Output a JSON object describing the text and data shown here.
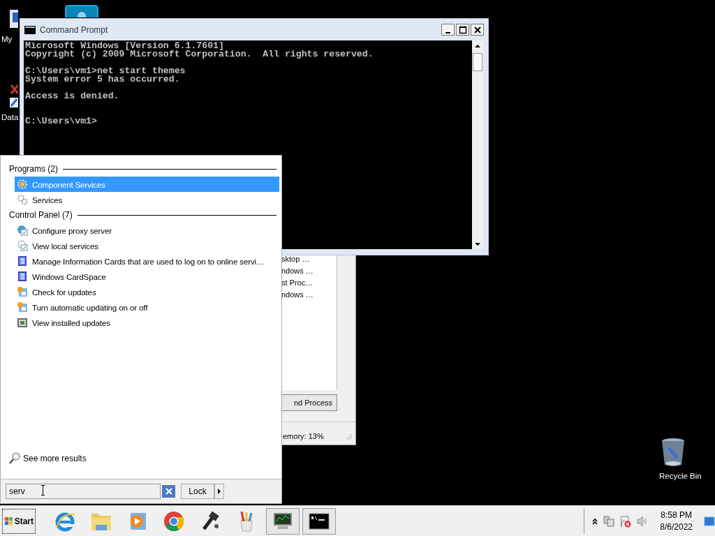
{
  "desktop_icons": [
    {
      "label": "My",
      "kind": "computer"
    },
    {
      "label": "Data",
      "kind": "shortcut"
    },
    {
      "label": "Recycle Bin",
      "kind": "bin"
    }
  ],
  "task_manager": {
    "rows": [
      "sktop …",
      "ndows …",
      "st Proc…",
      "ndows …"
    ],
    "end_button": "nd Process",
    "status": "emory: 13%"
  },
  "command_prompt": {
    "title": "Command Prompt",
    "blocks": [
      [
        "Microsoft Windows [Version 6.1.7601]",
        "Copyright (c) 2009 Microsoft Corporation.  All rights reserved."
      ],
      [
        "C:\\Users\\vm1>net start themes",
        "System error 5 has occurred."
      ],
      [
        "Access is denied."
      ],
      [
        "C:\\Users\\vm1>"
      ]
    ]
  },
  "start_menu": {
    "groups": [
      {
        "heading": "Programs (2)",
        "items": [
          {
            "label": "Component Services",
            "kind": "component",
            "selected": true
          },
          {
            "label": "Services",
            "kind": "gears",
            "selected": false
          }
        ]
      },
      {
        "heading": "Control Panel (7)",
        "items": [
          {
            "label": "Configure proxy server",
            "kind": "globe-check",
            "selected": false
          },
          {
            "label": "View local services",
            "kind": "gear-check",
            "selected": false
          },
          {
            "label": "Manage Information Cards that are used to log on to online servi…",
            "kind": "card",
            "selected": false
          },
          {
            "label": "Windows CardSpace",
            "kind": "card",
            "selected": false
          },
          {
            "label": "Check for updates",
            "kind": "update",
            "selected": false
          },
          {
            "label": "Turn automatic updating on or off",
            "kind": "update",
            "selected": false
          },
          {
            "label": "View installed updates",
            "kind": "installed",
            "selected": false
          }
        ]
      }
    ],
    "see_more": "See more results",
    "search": {
      "value": "serv"
    },
    "lock_button": "Lock"
  },
  "taskbar": {
    "start": "Start",
    "apps": [
      {
        "kind": "e-browser",
        "running": false
      },
      {
        "kind": "folder",
        "running": false
      },
      {
        "kind": "media",
        "running": false
      },
      {
        "kind": "ring-browser",
        "running": false
      },
      {
        "kind": "tool",
        "running": false
      },
      {
        "kind": "paint",
        "running": false
      },
      {
        "kind": "monitor",
        "running": true
      },
      {
        "kind": "console",
        "running": true
      }
    ],
    "clock": {
      "time": "8:58 PM",
      "date": "8/6/2022"
    }
  }
}
